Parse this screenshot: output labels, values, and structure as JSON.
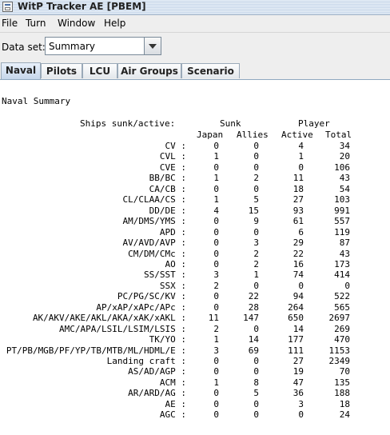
{
  "window": {
    "title": "WitP Tracker AE [PBEM]"
  },
  "menu": [
    {
      "label": "File"
    },
    {
      "label": "Turn"
    },
    {
      "label": "Window"
    },
    {
      "label": "Help"
    }
  ],
  "dataset": {
    "label": "Data set:",
    "selected": "Summary"
  },
  "tabs": [
    {
      "label": "Naval",
      "active": true
    },
    {
      "label": "Pilots"
    },
    {
      "label": "LCU"
    },
    {
      "label": "Air Groups"
    },
    {
      "label": "Scenario"
    }
  ],
  "report": {
    "heading": "Naval Summary",
    "caption": "Ships sunk/active:",
    "group_sunk": "Sunk",
    "group_player": "Player",
    "columns": [
      "Japan",
      "Allies",
      "Active",
      "Total"
    ],
    "rows": [
      {
        "label": "CV",
        "v": [
          "0",
          "0",
          "4",
          "34"
        ]
      },
      {
        "label": "CVL",
        "v": [
          "1",
          "0",
          "1",
          "20"
        ]
      },
      {
        "label": "CVE",
        "v": [
          "0",
          "0",
          "0",
          "106"
        ]
      },
      {
        "label": "BB/BC",
        "v": [
          "1",
          "2",
          "11",
          "43"
        ]
      },
      {
        "label": "CA/CB",
        "v": [
          "0",
          "0",
          "18",
          "54"
        ]
      },
      {
        "label": "CL/CLAA/CS",
        "v": [
          "1",
          "5",
          "27",
          "103"
        ]
      },
      {
        "label": "DD/DE",
        "v": [
          "4",
          "15",
          "93",
          "991"
        ]
      },
      {
        "label": "AM/DMS/YMS",
        "v": [
          "0",
          "9",
          "61",
          "557"
        ]
      },
      {
        "label": "APD",
        "v": [
          "0",
          "0",
          "6",
          "119"
        ]
      },
      {
        "label": "AV/AVD/AVP",
        "v": [
          "0",
          "3",
          "29",
          "87"
        ]
      },
      {
        "label": "CM/DM/CMc",
        "v": [
          "0",
          "2",
          "22",
          "43"
        ]
      },
      {
        "label": "AO",
        "v": [
          "0",
          "2",
          "16",
          "173"
        ]
      },
      {
        "label": "SS/SST",
        "v": [
          "3",
          "1",
          "74",
          "414"
        ]
      },
      {
        "label": "SSX",
        "v": [
          "2",
          "0",
          "0",
          "0"
        ]
      },
      {
        "label": "PC/PG/SC/KV",
        "v": [
          "0",
          "22",
          "94",
          "522"
        ]
      },
      {
        "label": "AP/xAP/xAPc/APc",
        "v": [
          "0",
          "28",
          "264",
          "565"
        ]
      },
      {
        "label": "AK/AKV/AKE/AKL/AKA/xAK/xAKL",
        "v": [
          "11",
          "147",
          "650",
          "2697"
        ]
      },
      {
        "label": "AMC/APA/LSIL/LSIM/LSIS",
        "v": [
          "2",
          "0",
          "14",
          "269"
        ]
      },
      {
        "label": "TK/YO",
        "v": [
          "1",
          "14",
          "177",
          "470"
        ]
      },
      {
        "label": "PT/PB/MGB/PF/YP/TB/MTB/ML/HDML/E",
        "v": [
          "3",
          "69",
          "111",
          "1153"
        ]
      },
      {
        "label": "Landing craft",
        "v": [
          "0",
          "0",
          "27",
          "2349"
        ]
      },
      {
        "label": "AS/AD/AGP",
        "v": [
          "0",
          "0",
          "19",
          "70"
        ]
      },
      {
        "label": "ACM",
        "v": [
          "1",
          "8",
          "47",
          "135"
        ]
      },
      {
        "label": "AR/ARD/AG",
        "v": [
          "0",
          "5",
          "36",
          "188"
        ]
      },
      {
        "label": "AE",
        "v": [
          "0",
          "0",
          "3",
          "18"
        ]
      },
      {
        "label": "AGC",
        "v": [
          "0",
          "0",
          "0",
          "24"
        ]
      }
    ]
  }
}
